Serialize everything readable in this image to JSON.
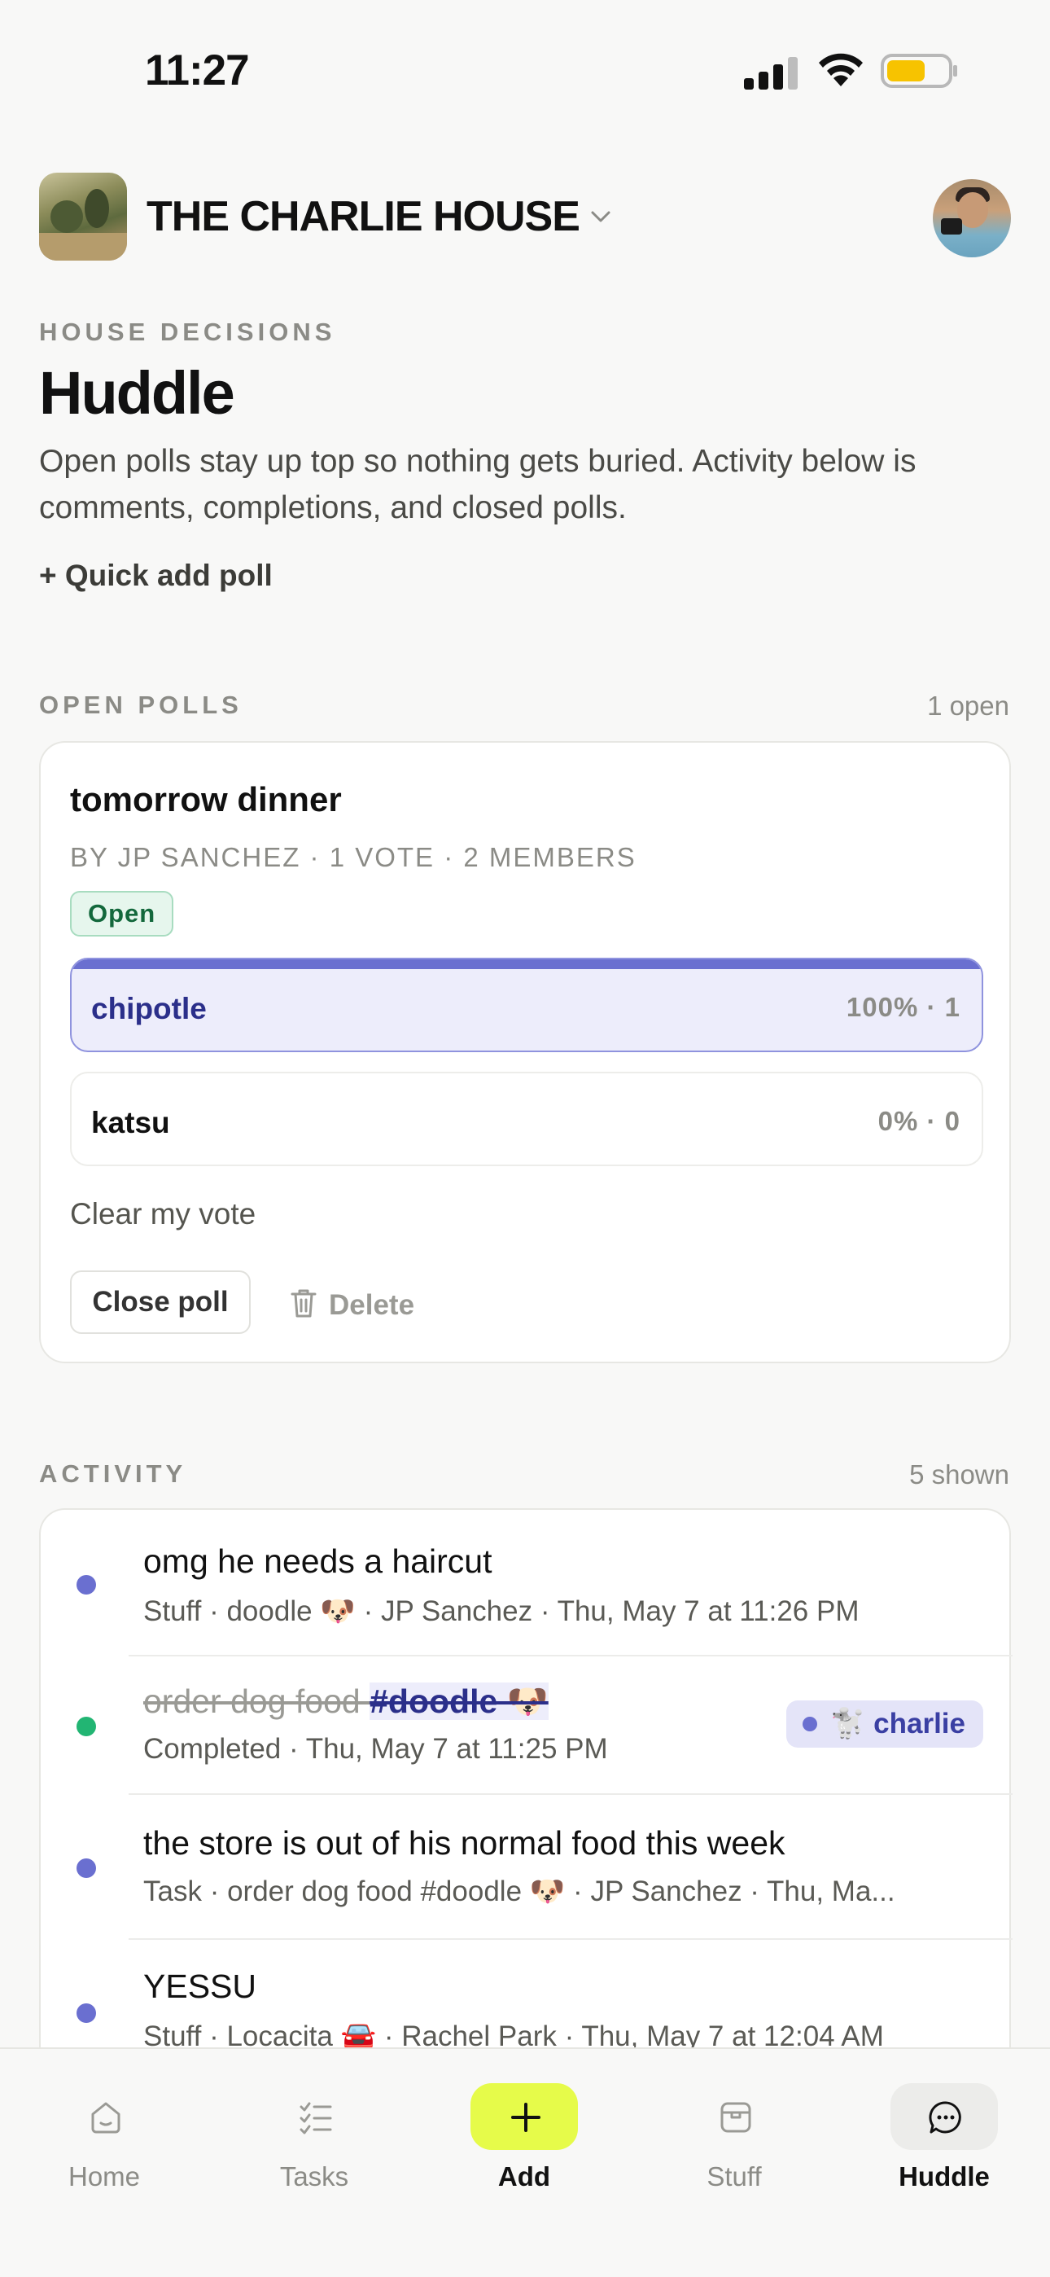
{
  "status_bar": {
    "time": "11:27"
  },
  "header": {
    "house_name": "THE CHARLIE HOUSE"
  },
  "page": {
    "eyebrow": "HOUSE DECISIONS",
    "title": "Huddle",
    "description": "Open polls stay up top so nothing gets buried. Activity below is comments, completions, and closed polls.",
    "quick_add_label": "+ Quick add poll"
  },
  "open_polls": {
    "section_label": "OPEN POLLS",
    "count_label": "1 open",
    "polls": [
      {
        "title": "tomorrow dinner",
        "meta": "BY JP SANCHEZ · 1 VOTE · 2 MEMBERS",
        "status": "Open",
        "options": [
          {
            "label": "chipotle",
            "stat": "100% · 1",
            "share": 1.0,
            "selected": true
          },
          {
            "label": "katsu",
            "stat": "0% · 0",
            "share": 0.0,
            "selected": false
          }
        ],
        "clear_vote_label": "Clear my vote",
        "close_label": "Close poll",
        "delete_label": "Delete"
      }
    ]
  },
  "activity": {
    "section_label": "ACTIVITY",
    "count_label": "5 shown",
    "items": [
      {
        "title": "omg he needs a haircut",
        "sub": "Stuff · doodle 🐶 · JP Sanchez · Thu, May 7 at 11:26 PM",
        "dot_color": "#6a6fd0"
      },
      {
        "title_plain": "order dog food ",
        "title_tag": "#doodle 🐶",
        "sub": "Completed · Thu, May 7 at 11:25 PM",
        "dot_color": "#22b573",
        "pill": "🐩 charlie"
      },
      {
        "title": "the store is out of his normal food this week",
        "sub": "Task · order dog food #doodle 🐶 · JP Sanchez · Thu, Ma...",
        "dot_color": "#6a6fd0"
      },
      {
        "title": "YESSU",
        "sub": "Stuff · Locacita 🚘 · Rachel Park · Thu, May 7 at 12:04 AM",
        "dot_color": "#6a6fd0"
      }
    ]
  },
  "tab_bar": {
    "tabs": [
      {
        "label": "Home",
        "icon": "home-icon"
      },
      {
        "label": "Tasks",
        "icon": "tasks-icon"
      },
      {
        "label": "Add",
        "icon": "plus-icon"
      },
      {
        "label": "Stuff",
        "icon": "box-icon"
      },
      {
        "label": "Huddle",
        "icon": "chat-icon"
      }
    ],
    "active": "Huddle"
  }
}
